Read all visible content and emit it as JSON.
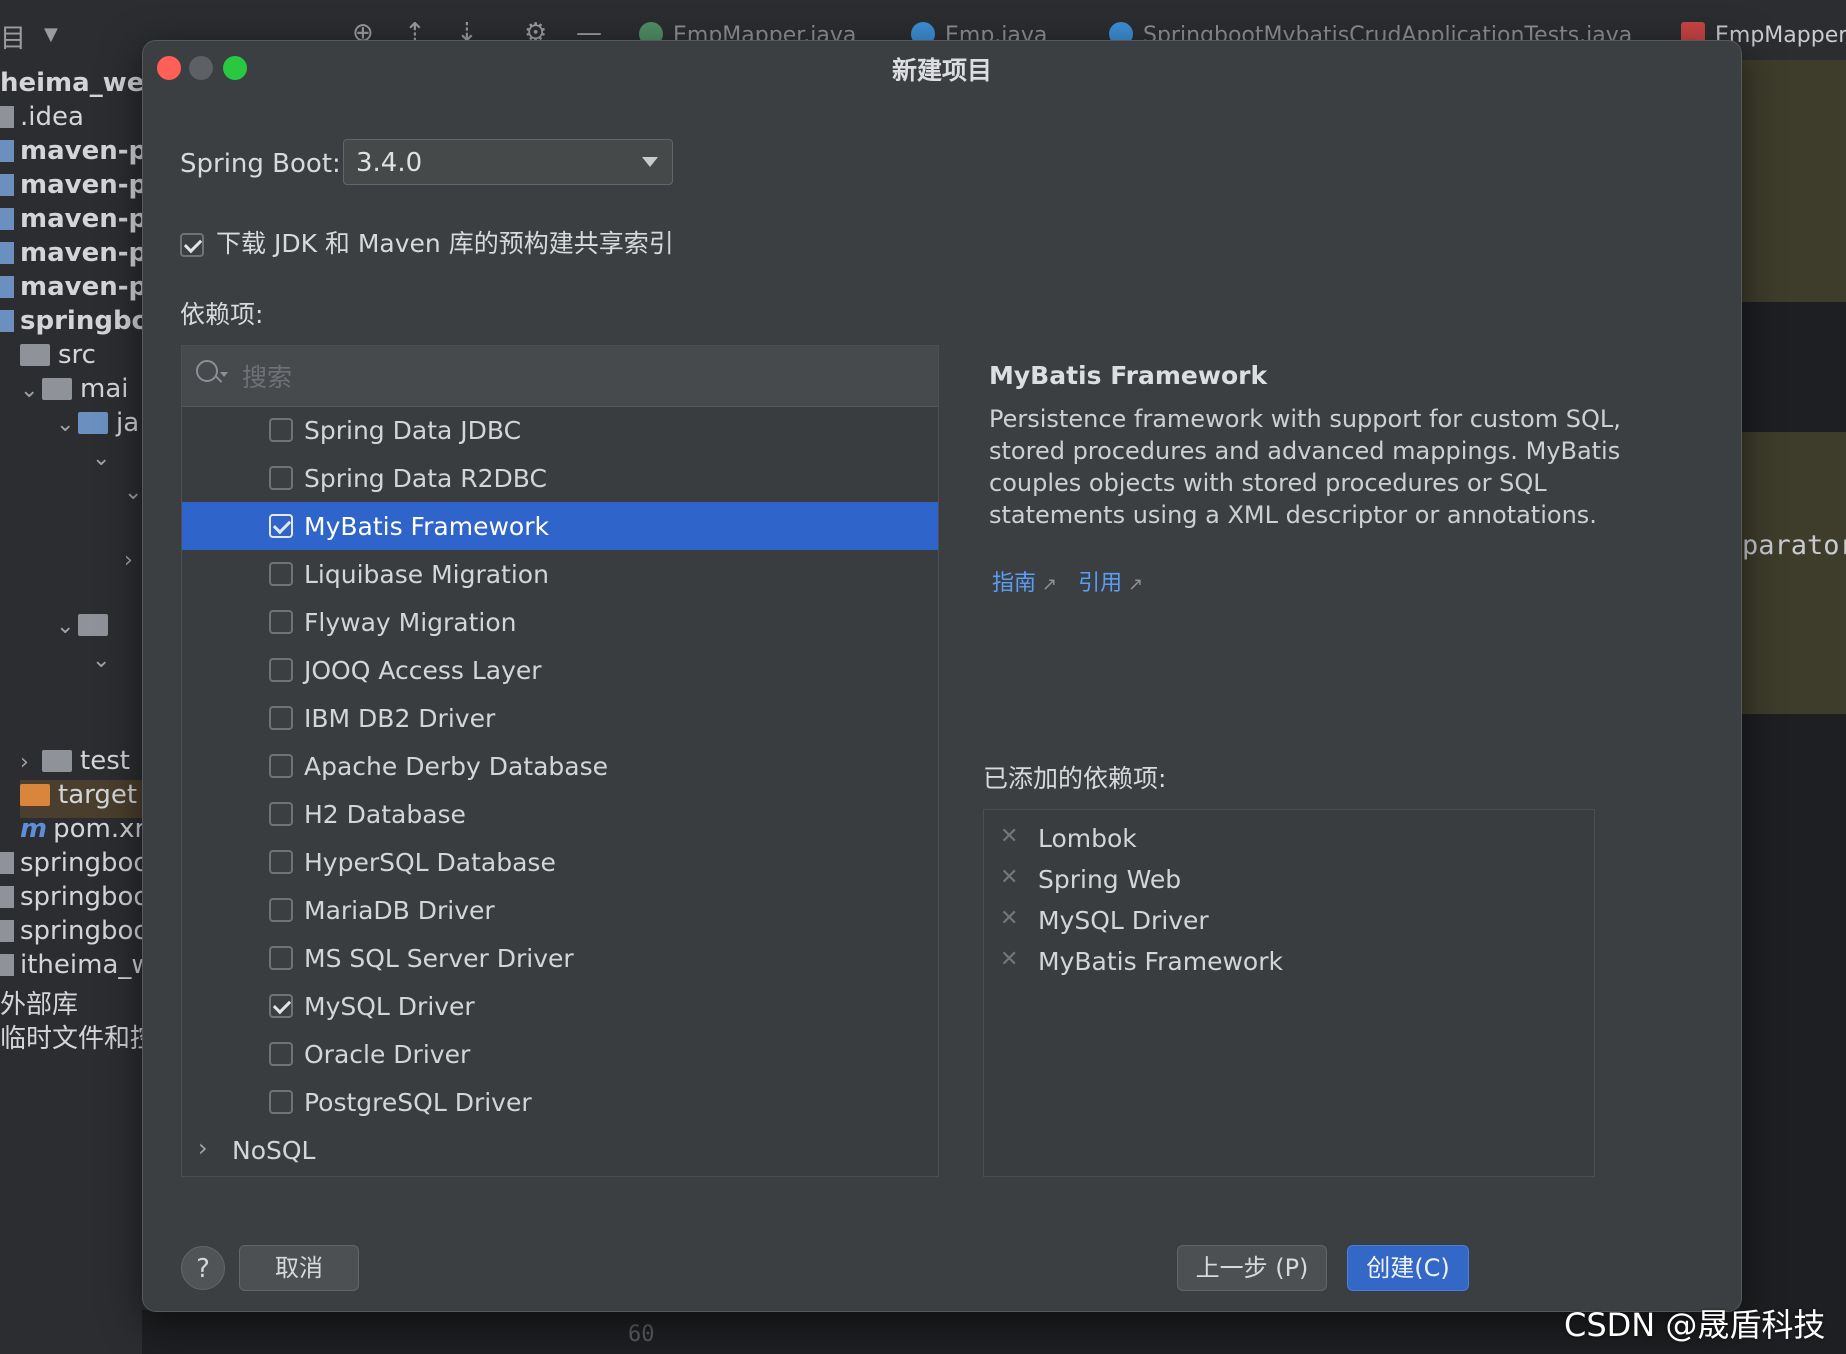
{
  "ide": {
    "tabs": [
      "EmpMapper.java",
      "Emp.java",
      "SpringbootMybatisCrudApplicationTests.java",
      "EmpMapper."
    ],
    "tree": [
      {
        "label": "heima_wel",
        "bold": true
      },
      {
        "label": ".idea"
      },
      {
        "label": "maven-pr",
        "bold": true
      },
      {
        "label": "maven-pr",
        "bold": true
      },
      {
        "label": "maven-pr",
        "bold": true
      },
      {
        "label": "maven-pr",
        "bold": true
      },
      {
        "label": "maven-pr",
        "bold": true
      },
      {
        "label": "springbo",
        "bold": true
      },
      {
        "label": "src"
      },
      {
        "label": "mai"
      },
      {
        "label": "ja"
      },
      {
        "label": "test"
      },
      {
        "label": "target"
      },
      {
        "label": "pom.xr"
      },
      {
        "label": "springboo"
      },
      {
        "label": "springboo"
      },
      {
        "label": "springboo"
      },
      {
        "label": "itheima_w"
      },
      {
        "label": "外部库"
      },
      {
        "label": "临时文件和控"
      }
    ],
    "editor_snippet": "parator",
    "line_number": "60"
  },
  "dialog": {
    "title": "新建项目",
    "spring_boot_label": "Spring Boot:",
    "spring_boot_version": "3.4.0",
    "jdk_index_label": "下载 JDK 和 Maven 库的预构建共享索引",
    "jdk_index_checked": true,
    "dependencies_label": "依赖项:",
    "search_placeholder": "搜索",
    "dependency_items": [
      {
        "label": "Spring Data JDBC",
        "checked": false,
        "selected": false
      },
      {
        "label": "Spring Data R2DBC",
        "checked": false,
        "selected": false
      },
      {
        "label": "MyBatis Framework",
        "checked": true,
        "selected": true
      },
      {
        "label": "Liquibase Migration",
        "checked": false,
        "selected": false
      },
      {
        "label": "Flyway Migration",
        "checked": false,
        "selected": false
      },
      {
        "label": "JOOQ Access Layer",
        "checked": false,
        "selected": false
      },
      {
        "label": "IBM DB2 Driver",
        "checked": false,
        "selected": false
      },
      {
        "label": "Apache Derby Database",
        "checked": false,
        "selected": false
      },
      {
        "label": "H2 Database",
        "checked": false,
        "selected": false
      },
      {
        "label": "HyperSQL Database",
        "checked": false,
        "selected": false
      },
      {
        "label": "MariaDB Driver",
        "checked": false,
        "selected": false
      },
      {
        "label": "MS SQL Server Driver",
        "checked": false,
        "selected": false
      },
      {
        "label": "MySQL Driver",
        "checked": true,
        "selected": false
      },
      {
        "label": "Oracle Driver",
        "checked": false,
        "selected": false
      },
      {
        "label": "PostgreSQL Driver",
        "checked": false,
        "selected": false
      }
    ],
    "nosql_group": "NoSQL",
    "detail": {
      "title": "MyBatis Framework",
      "description": "Persistence framework with support for custom SQL, stored procedures and advanced mappings. MyBatis couples objects with stored procedures or SQL statements using a XML descriptor or annotations.",
      "link_guide": "指南",
      "link_reference": "引用",
      "link_color": "#5a9df4"
    },
    "added_label": "已添加的依赖项:",
    "added_items": [
      "Lombok",
      "Spring Web",
      "MySQL Driver",
      "MyBatis Framework"
    ],
    "buttons": {
      "help": "?",
      "cancel": "取消",
      "previous": "上一步 (P)",
      "create": "创建(C)"
    },
    "colors": {
      "selection": "#2f65ca",
      "primary_button": "#3468c7",
      "traffic_close": "#fe5f57",
      "traffic_min": "#5d6064",
      "traffic_max": "#28c840"
    }
  },
  "watermark": "CSDN @晟盾科技"
}
